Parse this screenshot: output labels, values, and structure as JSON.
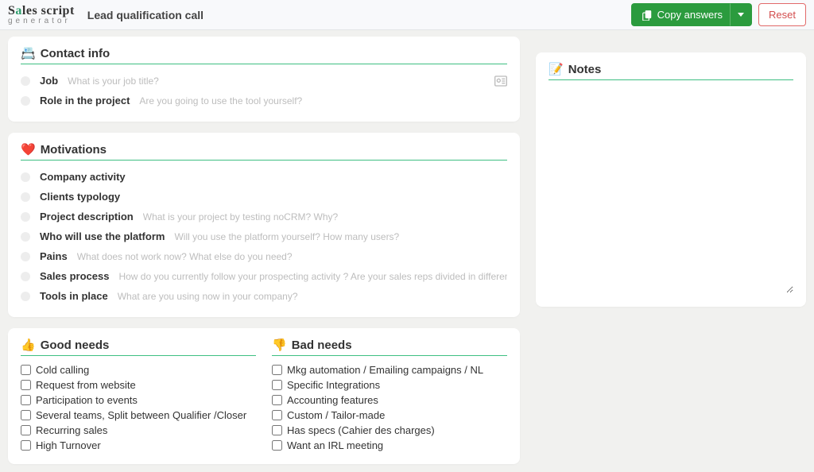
{
  "header": {
    "brand_line1": "Sales script",
    "brand_line2": "generator",
    "page_title": "Lead qualification call",
    "copy_label": "Copy answers",
    "reset_label": "Reset"
  },
  "contact": {
    "title": "Contact info",
    "icon": "📇",
    "fields": [
      {
        "label": "Job",
        "placeholder": "What is your job title?",
        "has_id_icon": true
      },
      {
        "label": "Role in the project",
        "placeholder": "Are you going to use the tool yourself?",
        "has_id_icon": false
      }
    ]
  },
  "motivations": {
    "title": "Motivations",
    "icon": "❤️",
    "fields": [
      {
        "label": "Company activity",
        "placeholder": ""
      },
      {
        "label": "Clients typology",
        "placeholder": ""
      },
      {
        "label": "Project description",
        "placeholder": "What is your project by testing noCRM? Why?"
      },
      {
        "label": "Who will use the platform",
        "placeholder": "Will you use the platform yourself? How many users?"
      },
      {
        "label": "Pains",
        "placeholder": "What does not work now? What else do you need?"
      },
      {
        "label": "Sales process",
        "placeholder": "How do you currently follow your prospecting activity ? Are your sales reps divided in different teams ?"
      },
      {
        "label": "Tools in place",
        "placeholder": "What are you using now in your company?"
      }
    ]
  },
  "good_needs": {
    "title": "Good needs",
    "icon": "👍",
    "items": [
      "Cold calling",
      "Request from website",
      "Participation to events",
      "Several teams, Split between Qualifier /Closer",
      "Recurring sales",
      "High Turnover"
    ]
  },
  "bad_needs": {
    "title": "Bad needs",
    "icon": "👎",
    "items": [
      "Mkg automation / Emailing campaigns / NL",
      "Specific Integrations",
      "Accounting features",
      "Custom / Tailor-made",
      "Has specs (Cahier des charges)",
      "Want an IRL meeting"
    ]
  },
  "notes": {
    "title": "Notes",
    "icon": "📝",
    "value": ""
  }
}
